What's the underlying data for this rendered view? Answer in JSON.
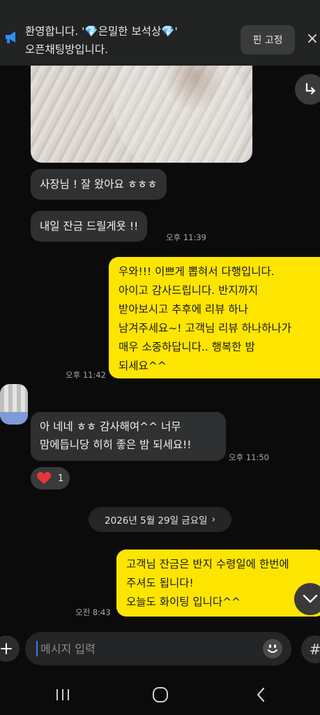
{
  "notice": {
    "line1_prefix": "환영합니다. '",
    "gem_left": "💎",
    "room_name": "은밀한 보석상",
    "gem_right": "💎",
    "line1_suffix": "'",
    "line2": "오픈채팅방입니다.",
    "pin_label": "핀 고정",
    "close_icon": "×"
  },
  "messages": {
    "m1": {
      "text": "사장님 ! 잘 왔아요 ㅎㅎㅎ"
    },
    "m2": {
      "text": "내일 잔금 드릴게욧 !!",
      "time": "오후 11:39"
    },
    "m3": {
      "lines": [
        "우와!!! 이쁘게 뽑혀서 다행입니다.",
        "아이고 감사드립니다. 반지까지",
        "받아보시고 추후에 리뷰 하나",
        "남겨주세요~! 고객님 리뷰 하나하나가",
        "매우 소중하답니다.. 행복한 밤",
        "되세요^^"
      ],
      "time": "오후 11:42"
    },
    "m4": {
      "lines": [
        "아 네네 ㅎㅎ 감사해여^^ 너무",
        "맘에듭니당 히히 좋은 밤 되세요!!"
      ],
      "time": "오후 11:50"
    },
    "reaction": {
      "icon": "heart-icon",
      "count": "1"
    },
    "date_divider": "2026년 5월 29일 금요일",
    "date_arrow": "›",
    "m5": {
      "lines": [
        "고객님 잔금은 반지 수령일에 한번에",
        "주셔도 됩니다!",
        "오늘도 화이팅 입니다^^"
      ],
      "time": "오전 8:43"
    }
  },
  "input": {
    "placeholder": "메시지 입력"
  },
  "colors": {
    "sent_bubble": "#fee500",
    "recv_bubble": "#2f3031",
    "background": "#0b0b0b",
    "heart": "#e8343c"
  }
}
